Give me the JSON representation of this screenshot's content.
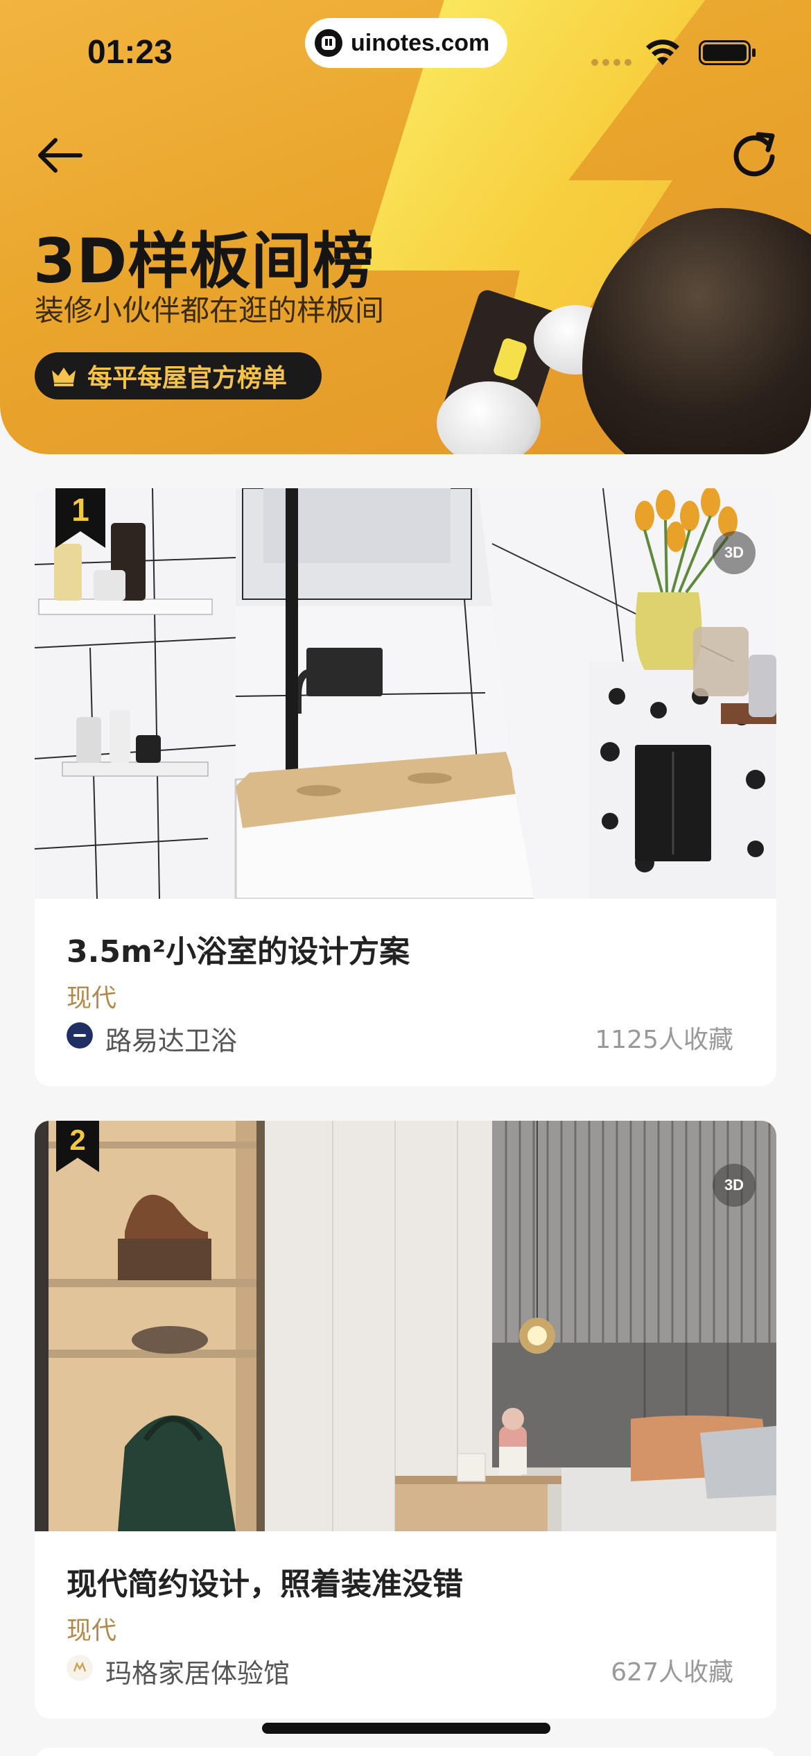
{
  "status_bar": {
    "time": "01:23",
    "site_watermark": "uinotes.com"
  },
  "header": {
    "title": "3D样板间榜",
    "subtitle": "装修小伙伴都在逛的样板间",
    "badge_label": "每平每屋官方榜单",
    "back_icon": "arrow-left-icon",
    "refresh_icon": "refresh-icon"
  },
  "colors": {
    "banner": "#e9a52c",
    "accent_gold": "#f5c24a",
    "style_tag": "#b08a4c"
  },
  "rankings": [
    {
      "rank": "1",
      "badge": "3D",
      "title": "3.5m²小浴室的设计方案",
      "style": "现代",
      "brand": "路易达卫浴",
      "favorites": "1125人收藏"
    },
    {
      "rank": "2",
      "badge": "3D",
      "title": "现代简约设计，照着装准没错",
      "style": "现代",
      "brand": "玛格家居体验馆",
      "favorites": "627人收藏"
    }
  ]
}
